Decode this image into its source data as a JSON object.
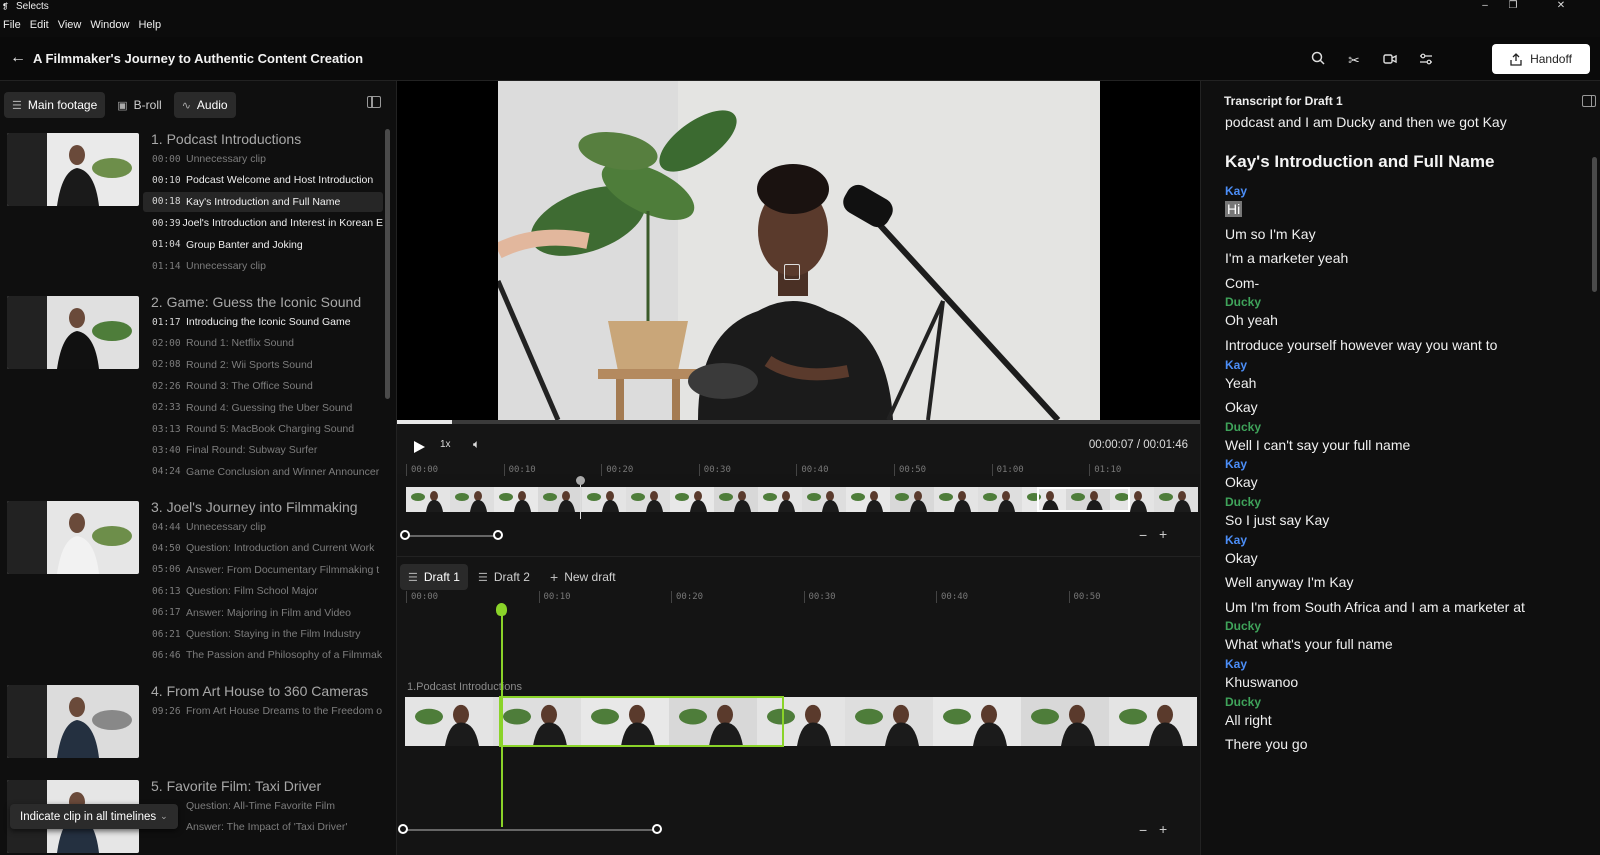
{
  "app": {
    "name": "Selects"
  },
  "menu": [
    "File",
    "Edit",
    "View",
    "Window",
    "Help"
  ],
  "header": {
    "title": "A Filmmaker's Journey to Authentic Content Creation",
    "handoff_label": "Handoff"
  },
  "left_tabs": [
    {
      "label": "Main footage",
      "icon": "list-icon",
      "active": true
    },
    {
      "label": "B-roll",
      "icon": "image-icon",
      "active": false
    },
    {
      "label": "Audio",
      "icon": "waveform-icon",
      "active": false
    }
  ],
  "sections": [
    {
      "title": "1. Podcast Introductions",
      "clips": [
        {
          "time": "00:00",
          "label": "Unnecessary clip",
          "dim": true
        },
        {
          "time": "00:10",
          "label": "Podcast Welcome and Host Introduction",
          "dim": false
        },
        {
          "time": "00:18",
          "label": "Kay's Introduction and Full Name",
          "dim": false,
          "selected": true
        },
        {
          "time": "00:39",
          "label": "Joel's Introduction and Interest in Korean E",
          "dim": false
        },
        {
          "time": "01:04",
          "label": "Group Banter and Joking",
          "dim": false
        },
        {
          "time": "01:14",
          "label": "Unnecessary clip",
          "dim": true
        }
      ]
    },
    {
      "title": "2. Game: Guess the Iconic Sound",
      "clips": [
        {
          "time": "01:17",
          "label": "Introducing the Iconic Sound Game",
          "dim": false
        },
        {
          "time": "02:00",
          "label": "Round 1: Netflix Sound",
          "dim": true
        },
        {
          "time": "02:08",
          "label": "Round 2: Wii Sports Sound",
          "dim": true
        },
        {
          "time": "02:26",
          "label": "Round 3: The Office Sound",
          "dim": true
        },
        {
          "time": "02:33",
          "label": "Round 4: Guessing the Uber Sound",
          "dim": true
        },
        {
          "time": "03:13",
          "label": "Round 5: MacBook Charging Sound",
          "dim": true
        },
        {
          "time": "03:40",
          "label": "Final Round: Subway Surfer",
          "dim": true
        },
        {
          "time": "04:24",
          "label": "Game Conclusion and Winner Announcer",
          "dim": true
        }
      ]
    },
    {
      "title": "3. Joel's Journey into Filmmaking",
      "clips": [
        {
          "time": "04:44",
          "label": "Unnecessary clip",
          "dim": true
        },
        {
          "time": "04:50",
          "label": "Question: Introduction and Current Work",
          "dim": true
        },
        {
          "time": "05:06",
          "label": "Answer: From Documentary Filmmaking t",
          "dim": true
        },
        {
          "time": "06:13",
          "label": "Question: Film School Major",
          "dim": true
        },
        {
          "time": "06:17",
          "label": "Answer: Majoring in Film and Video",
          "dim": true
        },
        {
          "time": "06:21",
          "label": "Question: Staying in the Film Industry",
          "dim": true
        },
        {
          "time": "06:46",
          "label": "The Passion and Philosophy of a Filmmak",
          "dim": true
        }
      ]
    },
    {
      "title": "4. From Art House to 360 Cameras",
      "clips": [
        {
          "time": "09:26",
          "label": "From Art House Dreams to the Freedom o",
          "dim": true
        }
      ]
    },
    {
      "title": "5. Favorite Film: Taxi Driver",
      "clips": [
        {
          "time": "",
          "label": "Question: All-Time Favorite Film",
          "dim": true
        },
        {
          "time": "",
          "label": "Answer: The Impact of 'Taxi Driver'",
          "dim": true
        }
      ]
    }
  ],
  "indicate_label": "Indicate clip in all timelines",
  "player": {
    "speed": "1x",
    "timecode": "00:00:07 / 00:01:46",
    "progress": 0.068
  },
  "ruler_top": [
    "00:00",
    "00:10",
    "00:20",
    "00:30",
    "00:40",
    "00:50",
    "01:00",
    "01:10"
  ],
  "ruler_bottom": [
    "00:00",
    "00:10",
    "00:20",
    "00:30",
    "00:40",
    "00:50"
  ],
  "drafts": [
    {
      "label": "Draft 1",
      "active": true
    },
    {
      "label": "Draft 2",
      "active": false
    },
    {
      "label": "New draft",
      "active": false
    }
  ],
  "track_label": "1.Podcast Introductions",
  "transcript": {
    "title": "Transcript for Draft 1",
    "top_line": "podcast and I am Ducky and then we got Kay",
    "heading": "Kay's Introduction and Full Name",
    "blocks": [
      {
        "speaker": "Kay",
        "lines": [
          "Hi",
          "Um so I'm Kay",
          "I'm a marketer yeah",
          "Com-"
        ]
      },
      {
        "speaker": "Ducky",
        "lines": [
          "Oh yeah",
          "Introduce yourself however way you want to"
        ]
      },
      {
        "speaker": "Kay",
        "lines": [
          "Yeah",
          "Okay"
        ]
      },
      {
        "speaker": "Ducky",
        "lines": [
          "Well I can't say your full name"
        ]
      },
      {
        "speaker": "Kay",
        "lines": [
          "Okay"
        ]
      },
      {
        "speaker": "Ducky",
        "lines": [
          "So I just say Kay"
        ]
      },
      {
        "speaker": "Kay",
        "lines": [
          "Okay",
          "Well anyway I'm Kay",
          "Um I'm from South Africa and I am a marketer at"
        ]
      },
      {
        "speaker": "Ducky",
        "lines": [
          "What what's your full name"
        ]
      },
      {
        "speaker": "Kay",
        "lines": [
          "Khuswanoo"
        ]
      },
      {
        "speaker": "Ducky",
        "lines": [
          "All right",
          "There you go"
        ]
      }
    ]
  },
  "colors": {
    "accent_green": "#8ad329",
    "kay_blue": "#4c8ef7",
    "ducky_green": "#3fa35a"
  }
}
